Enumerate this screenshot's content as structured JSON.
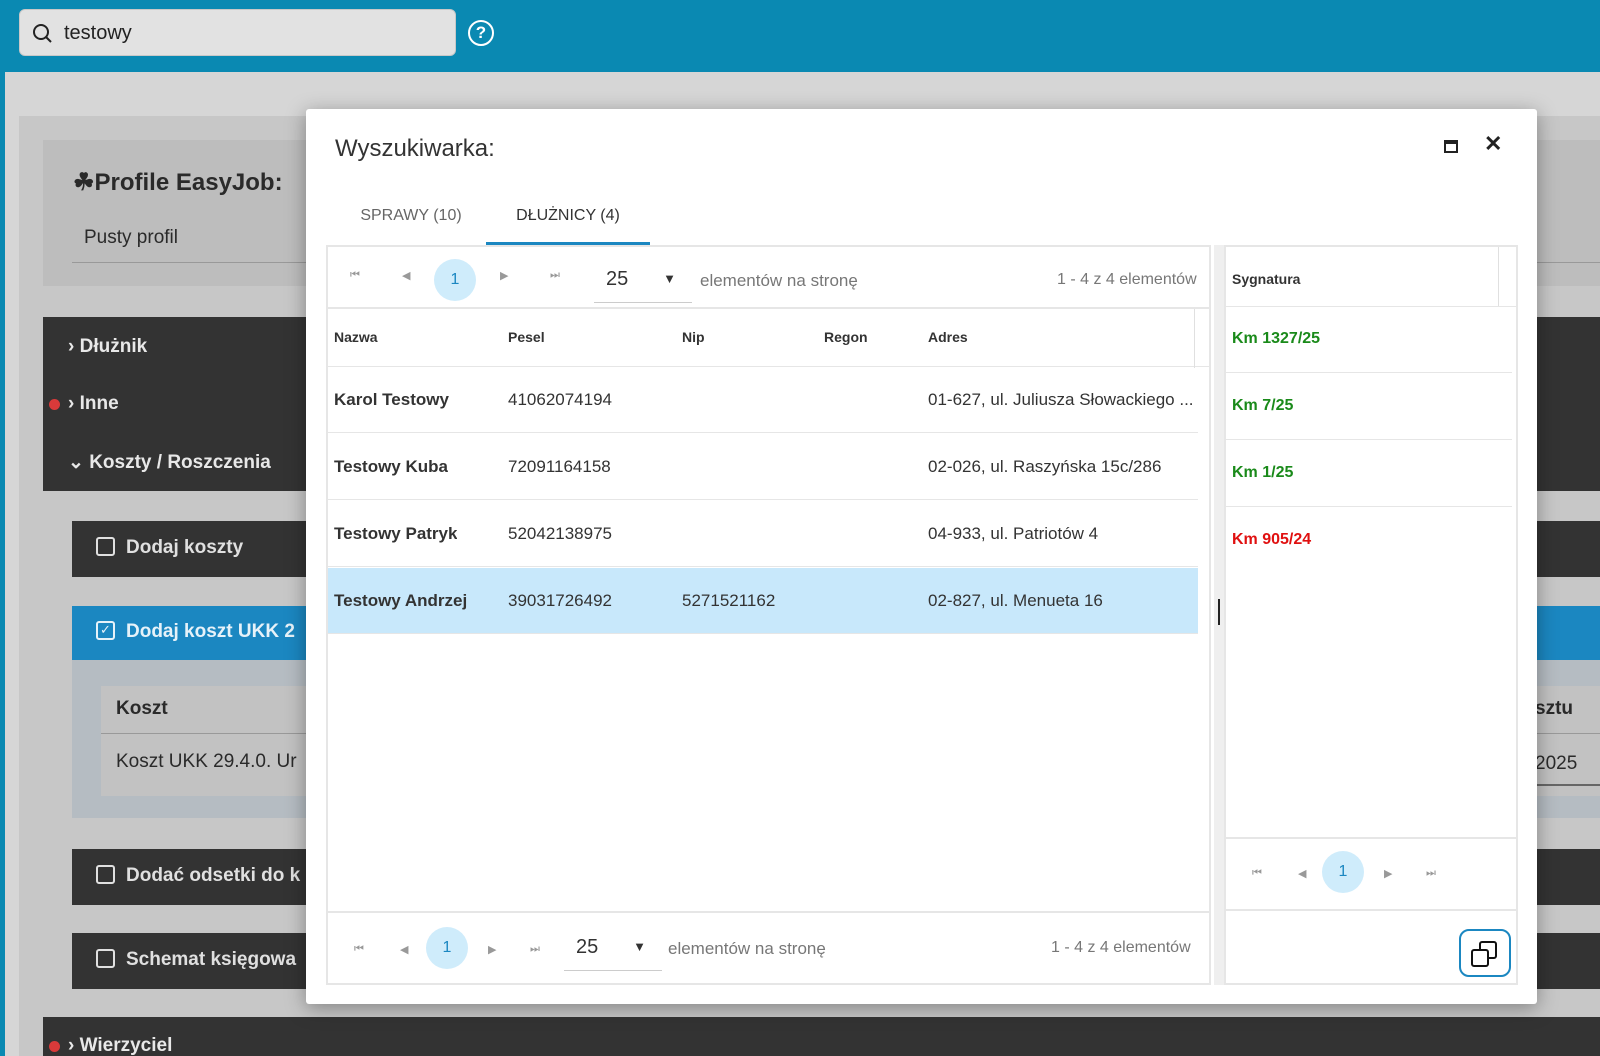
{
  "search": {
    "value": "testowy"
  },
  "profile": {
    "title": "Profile EasyJob:",
    "subtitle": "Pusty profil"
  },
  "accordion": [
    "Dłużnik",
    "Inne",
    "Koszty / Roszczenia",
    "Wierzyciel"
  ],
  "cost_buttons": {
    "add_costs": "Dodaj koszty",
    "add_ukk": "Dodaj koszt UKK 2",
    "add_interest": "Dodać odsetki do k",
    "accounting": "Schemat księgowa"
  },
  "cost_table": {
    "header": "Koszt",
    "value": "Koszt UKK 29.4.0. Ur",
    "right_header": "sztu",
    "right_value": "2025"
  },
  "modal": {
    "title": "Wyszukiwarka:",
    "tabs": [
      {
        "label": "SPRAWY (10)",
        "active": false
      },
      {
        "label": "DŁUŻNICY (4)",
        "active": true
      }
    ]
  },
  "grid": {
    "page_current": "1",
    "page_size": "25",
    "per_page_label": "elementów na stronę",
    "count_label": "1 - 4 z 4 elementów",
    "columns": [
      "Nazwa",
      "Pesel",
      "Nip",
      "Regon",
      "Adres"
    ],
    "rows": [
      {
        "name": "Karol Testowy",
        "pesel": "41062074194",
        "nip": "",
        "regon": "",
        "address": "01-627, ul. Juliusza Słowackiego ...",
        "selected": false
      },
      {
        "name": "Testowy Kuba",
        "pesel": "72091164158",
        "nip": "",
        "regon": "",
        "address": "02-026, ul. Raszyńska 15c/286",
        "selected": false
      },
      {
        "name": "Testowy Patryk",
        "pesel": "52042138975",
        "nip": "",
        "regon": "",
        "address": "04-933, ul. Patriotów 4",
        "selected": false
      },
      {
        "name": "Testowy Andrzej",
        "pesel": "39031726492",
        "nip": "5271521162",
        "regon": "",
        "address": "02-827, ul. Menueta 16",
        "selected": true
      }
    ]
  },
  "side_panel": {
    "header": "Sygnatura",
    "page_current": "1",
    "items": [
      {
        "label": "Km 1327/25",
        "color": "#1a8a1a"
      },
      {
        "label": "Km 7/25",
        "color": "#1a8a1a"
      },
      {
        "label": "Km 1/25",
        "color": "#1a8a1a"
      },
      {
        "label": "Km 905/24",
        "color": "#e01010"
      }
    ]
  },
  "icons": {
    "search": "search-icon",
    "help": "help-icon",
    "maximize": "maximize-icon",
    "close": "close-icon",
    "copy": "copy-icon"
  }
}
